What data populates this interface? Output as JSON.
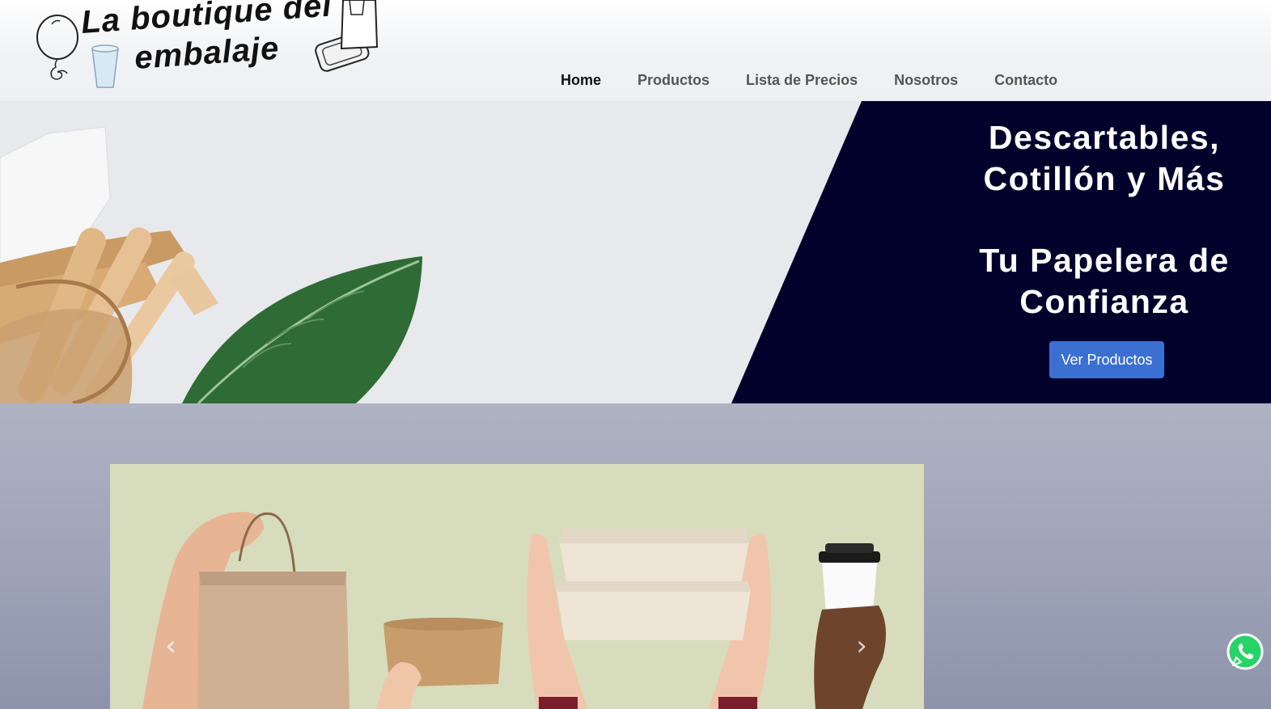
{
  "brand": {
    "logo_line1": "La boutique del",
    "logo_line2": "embalaje"
  },
  "nav": {
    "items": [
      {
        "label": "Home",
        "active": true
      },
      {
        "label": "Productos",
        "active": false
      },
      {
        "label": "Lista de Precios",
        "active": false
      },
      {
        "label": "Nosotros",
        "active": false
      },
      {
        "label": "Contacto",
        "active": false
      }
    ]
  },
  "hero": {
    "title_line1": "Descartables,",
    "title_line2": "Cotillón y Más",
    "subtitle_line1": "Tu Papelera de",
    "subtitle_line2": "Confianza",
    "cta_label": "Ver Productos",
    "panel_color": "#01012c",
    "button_color": "#3b6fd1"
  },
  "carousel": {
    "prev_icon": "chevron-left-icon",
    "next_icon": "chevron-right-icon",
    "background": "#d7ddbc"
  },
  "floating": {
    "whatsapp_icon": "whatsapp-icon",
    "color": "#25d366"
  }
}
